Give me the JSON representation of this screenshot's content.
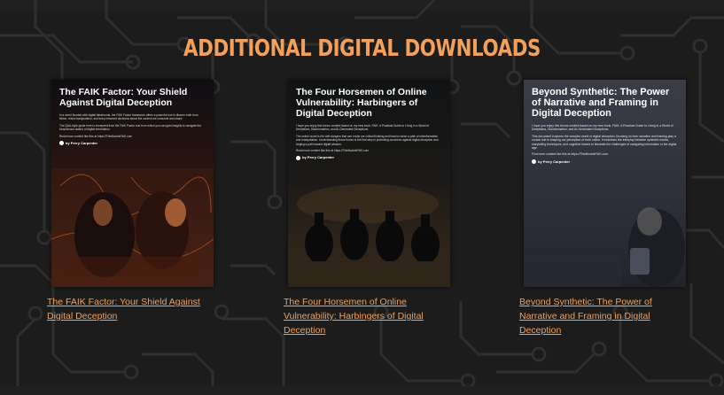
{
  "section": {
    "title": "ADDITIONAL DIGITAL DOWNLOADS"
  },
  "colors": {
    "accent": "#f3a05b",
    "background": "#1c1c1c",
    "trace": "#2e2e2e"
  },
  "cards": [
    {
      "cover_title": "The FAIK Factor: Your Shield Against Digital Deception",
      "cover_paragraphs": [
        "In a world flooded with digital falsehoods, the FAIK Factor framework offers a powerful tool to discern truth from fiction, resist manipulation, and keep informed decisions about the content we consume and share.",
        "The Q&A-style guide here is excerpted from the FAIK Factor and from which you can gain insights to navigate the treacherous waters of digital information.",
        "Read more content like this at https://ThisBookIsFAIK.com"
      ],
      "author": "by Perry Carpenter",
      "link": "The FAIK Factor: Your Shield Against Digital Deception"
    },
    {
      "cover_title": "The Four Horsemen of Online Vulnerability: Harbingers of Digital Deception",
      "cover_paragraphs": [
        "I hope you enjoy this bonus content based on my new book, FAIK: A Practical Guide to Living in a World of Deepfakes, Disinformation, and AI-Generated Deceptions.",
        "The online world is rife with dangers that can erode our critical thinking and lead us down a path of misinformation and manipulation. Understanding these forces is the first step in protecting ourselves against digital deception and forging a path toward digital wisdom.",
        "Read more content like this at https://ThisBookIsFAIK.com"
      ],
      "author": "by Perry Carpenter",
      "link": "The Four Horsemen of Online Vulnerability: Harbingers of Digital Deception"
    },
    {
      "cover_title": "Beyond Synthetic: The Power of Narrative and Framing in Digital Deception",
      "cover_paragraphs": [
        "I hope you enjoy this bonus content based on my new book, FAIK: A Practical Guide to Living in a World of Deepfakes, Disinformation, and AI-Generated Deceptions.",
        "This document explores the complex world of digital deception, focusing on how narrative and framing play a crucial role in shaping our perception of truth online. It examines the interplay between synthetic media, storytelling techniques, and cognitive biases to illustrate the challenges of navigating information in the digital age.",
        "Find more content like this at https://ThisBookIsFAIK.com"
      ],
      "author": "by Perry Carpenter",
      "link": "Beyond Synthetic: The Power of Narrative and Framing in Digital Deception"
    }
  ]
}
